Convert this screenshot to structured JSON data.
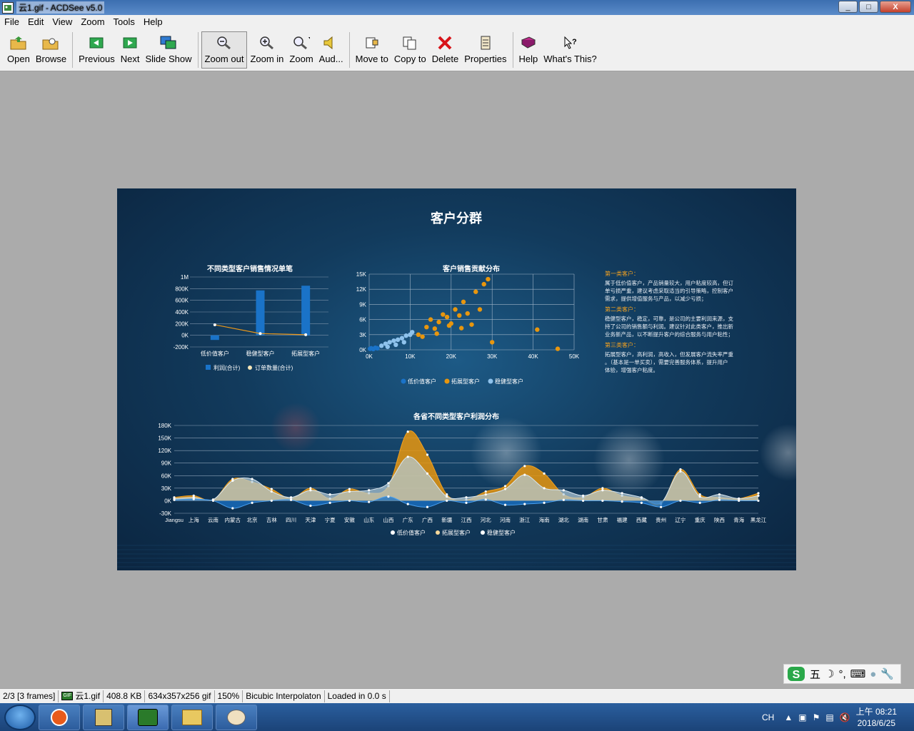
{
  "window": {
    "title": "云1.gif - ACDSee v5.0",
    "min": "_",
    "max": "□",
    "close": "X"
  },
  "menu": [
    "File",
    "Edit",
    "View",
    "Zoom",
    "Tools",
    "Help"
  ],
  "toolbar": {
    "open": "Open",
    "browse": "Browse",
    "previous": "Previous",
    "next": "Next",
    "slideshow": "Slide Show",
    "zoomout": "Zoom out",
    "zoomin": "Zoom in",
    "zoom": "Zoom",
    "audio": "Aud...",
    "moveto": "Move to",
    "copyto": "Copy to",
    "delete": "Delete",
    "properties": "Properties",
    "help": "Help",
    "whatsthis": "What's This?"
  },
  "dashboard": {
    "title": "客户分群",
    "bar_chart": {
      "title": "不同类型客户销售情况单笔",
      "categories": [
        "低价值客户",
        "稳健型客户",
        "拓展型客户"
      ],
      "y_ticks": [
        "1M",
        "800K",
        "600K",
        "400K",
        "200K",
        "0K",
        "-200K"
      ],
      "legend": [
        "利润(合计)",
        "订单数量(合计)"
      ]
    },
    "scatter_chart": {
      "title": "客户销售贡献分布",
      "x_ticks": [
        "0K",
        "10K",
        "20K",
        "30K",
        "40K",
        "50K"
      ],
      "y_ticks": [
        "15K",
        "12K",
        "9K",
        "6K",
        "3K",
        "0K"
      ],
      "legend": [
        "低价值客户",
        "拓展型客户",
        "稳健型客户"
      ]
    },
    "notes": [
      {
        "heading": "第一类客户：",
        "body": "属于低价值客户，产品销量较大，用户粘度较高，但订单亏损严重，建议考虑采取适当的引导策略，控制客户需求，提供增值服务与产品，以减少亏损；"
      },
      {
        "heading": "第二类客户：",
        "body": "稳健型客户，稳定，可靠，是公司的主要利润来源，支持了公司的销售额与利润。建议针对此类客户，推出新业务新产品，以不断提升客户的综合服务与用户粘性；"
      },
      {
        "heading": "第三类客户：",
        "body": "拓展型客户，高利润，高收入，但发展客户流失率严重。（基本是一单买卖），需要完善服务体系，提升用户体验，增强客户粘度。"
      }
    ],
    "area_chart": {
      "title": "各省不同类型客户利润分布",
      "y_ticks": [
        "180K",
        "150K",
        "120K",
        "90K",
        "60K",
        "30K",
        "0K",
        "-30K"
      ],
      "provinces": [
        "Jiangsu",
        "上海",
        "云南",
        "内蒙古",
        "北京",
        "吉林",
        "四川",
        "天津",
        "宁夏",
        "安徽",
        "山东",
        "山西",
        "广东",
        "广西",
        "新疆",
        "江西",
        "河北",
        "河南",
        "浙江",
        "海南",
        "湖北",
        "湖南",
        "甘肃",
        "福建",
        "西藏",
        "贵州",
        "辽宁",
        "重庆",
        "陕西",
        "青海",
        "黑龙江"
      ],
      "legend": [
        "低价值客户",
        "拓展型客户",
        "稳健型客户"
      ]
    }
  },
  "chart_data": [
    {
      "type": "bar",
      "title": "不同类型客户销售情况单笔",
      "categories": [
        "低价值客户",
        "稳健型客户",
        "拓展型客户"
      ],
      "series": [
        {
          "name": "利润(合计)",
          "values": [
            -80000,
            770000,
            850000
          ]
        },
        {
          "name": "订单数量(合计)",
          "values": [
            180000,
            30000,
            10000
          ]
        }
      ],
      "ylim": [
        -200000,
        1000000
      ]
    },
    {
      "type": "scatter",
      "title": "客户销售贡献分布",
      "xlim": [
        0,
        50000
      ],
      "ylim": [
        0,
        15000
      ],
      "series": [
        {
          "name": "低价值客户",
          "points": [
            [
              200,
              200
            ],
            [
              500,
              300
            ],
            [
              1000,
              150
            ],
            [
              1500,
              400
            ],
            [
              2000,
              300
            ]
          ]
        },
        {
          "name": "拓展型客户",
          "points": [
            [
              12000,
              3000
            ],
            [
              14000,
              4500
            ],
            [
              15000,
              6000
            ],
            [
              16000,
              4200
            ],
            [
              17000,
              5500
            ],
            [
              18000,
              7000
            ],
            [
              19000,
              6500
            ],
            [
              20000,
              5200
            ],
            [
              21000,
              8000
            ],
            [
              22000,
              6800
            ],
            [
              23000,
              9500
            ],
            [
              24000,
              7200
            ],
            [
              25000,
              5000
            ],
            [
              26000,
              11500
            ],
            [
              27000,
              8000
            ],
            [
              28000,
              13000
            ],
            [
              29000,
              14000
            ],
            [
              30000,
              1500
            ],
            [
              41000,
              4000
            ],
            [
              46000,
              200
            ],
            [
              13000,
              2600
            ],
            [
              16500,
              3200
            ],
            [
              19500,
              4800
            ],
            [
              22500,
              4300
            ]
          ]
        },
        {
          "name": "稳健型客户",
          "points": [
            [
              3000,
              800
            ],
            [
              4000,
              1200
            ],
            [
              5000,
              1500
            ],
            [
              6000,
              1800
            ],
            [
              7000,
              2000
            ],
            [
              8000,
              2300
            ],
            [
              9000,
              2800
            ],
            [
              10000,
              3000
            ],
            [
              4500,
              600
            ],
            [
              6500,
              1000
            ],
            [
              8500,
              1500
            ],
            [
              10500,
              3500
            ]
          ]
        }
      ]
    },
    {
      "type": "area",
      "title": "各省不同类型客户利润分布",
      "categories": [
        "Jiangsu",
        "上海",
        "云南",
        "内蒙古",
        "北京",
        "吉林",
        "四川",
        "天津",
        "宁夏",
        "安徽",
        "山东",
        "山西",
        "广东",
        "广西",
        "新疆",
        "江西",
        "河北",
        "河南",
        "浙江",
        "海南",
        "湖北",
        "湖南",
        "甘肃",
        "福建",
        "西藏",
        "贵州",
        "辽宁",
        "重庆",
        "陕西",
        "青海",
        "黑龙江"
      ],
      "ylim": [
        -30000,
        180000
      ],
      "series": [
        {
          "name": "低价值客户",
          "values": [
            2000,
            4000,
            0,
            -18000,
            -5000,
            0,
            2000,
            -12000,
            -5000,
            0,
            -3000,
            10000,
            -8000,
            -15000,
            0,
            -5000,
            3000,
            -10000,
            -8000,
            -5000,
            2000,
            0,
            0,
            -2000,
            -5000,
            -15000,
            0,
            -5000,
            2000,
            0,
            0
          ]
        },
        {
          "name": "拓展型客户",
          "values": [
            8000,
            12000,
            2000,
            52000,
            45000,
            28000,
            5000,
            30000,
            5000,
            28000,
            18000,
            35000,
            165000,
            110000,
            15000,
            2000,
            22000,
            35000,
            83000,
            65000,
            15000,
            8000,
            30000,
            12000,
            5000,
            -8000,
            75000,
            15000,
            8000,
            5000,
            18000
          ]
        },
        {
          "name": "稳健型客户",
          "values": [
            5000,
            8000,
            3000,
            48000,
            52000,
            22000,
            8000,
            25000,
            15000,
            22000,
            25000,
            42000,
            105000,
            65000,
            10000,
            8000,
            15000,
            28000,
            62000,
            30000,
            25000,
            12000,
            25000,
            18000,
            8000,
            -5000,
            70000,
            10000,
            15000,
            5000,
            12000
          ]
        }
      ]
    }
  ],
  "status": {
    "frame": "2/3 [3 frames]",
    "file": "云1.gif",
    "size": "408.8 KB",
    "dims": "634x357x256 gif",
    "zoom": "150%",
    "interp": "Bicubic Interpolaton",
    "loaded": "Loaded in 0.0 s"
  },
  "tray": {
    "lang": "CH",
    "time": "上午 08:21",
    "date": "2018/6/25"
  },
  "ime": {
    "mode": "五"
  }
}
